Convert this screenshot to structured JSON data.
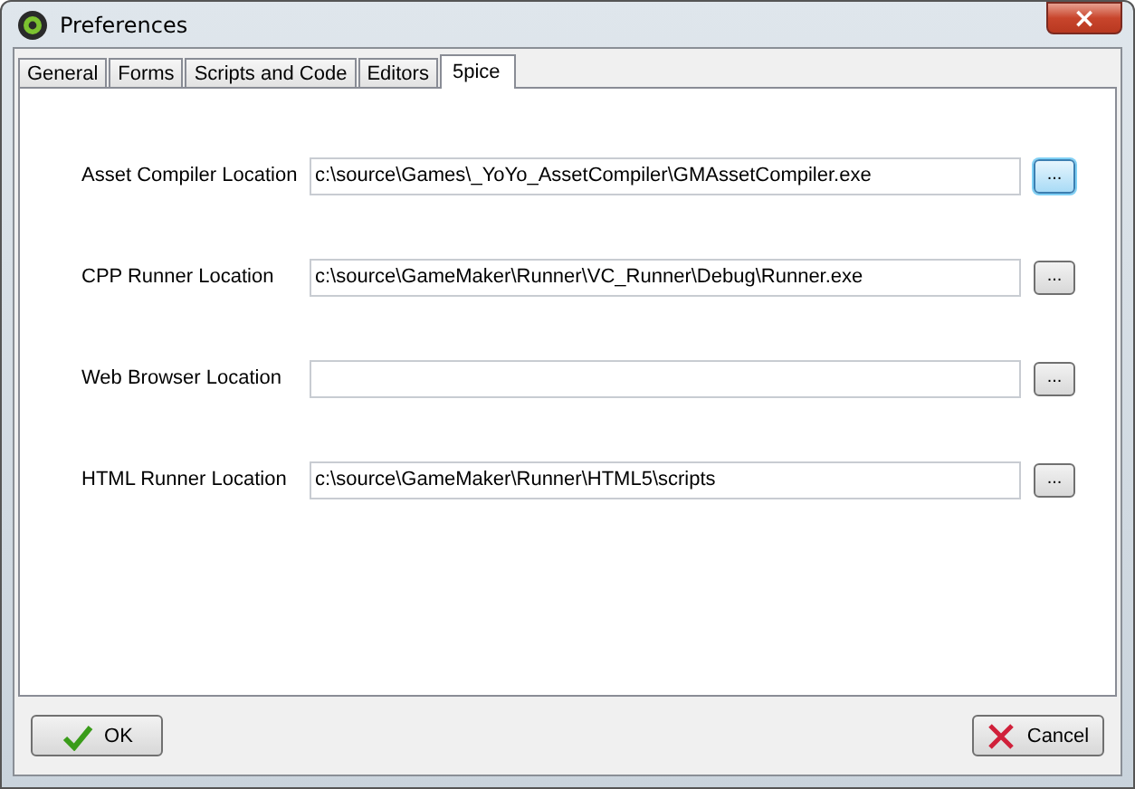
{
  "window": {
    "title": "Preferences",
    "close": "×"
  },
  "tabs": [
    {
      "label": "General",
      "selected": false
    },
    {
      "label": "Forms",
      "selected": false
    },
    {
      "label": "Scripts and Code",
      "selected": false
    },
    {
      "label": "Editors",
      "selected": false
    },
    {
      "label": "5pice",
      "selected": true
    }
  ],
  "settings": [
    {
      "label": "Asset Compiler Location",
      "value": "c:\\source\\Games\\_YoYo_AssetCompiler\\GMAssetCompiler.exe",
      "browse": "...",
      "focused": true
    },
    {
      "label": "CPP Runner Location",
      "value": "c:\\source\\GameMaker\\Runner\\VC_Runner\\Debug\\Runner.exe",
      "browse": "...",
      "focused": false
    },
    {
      "label": "Web Browser Location",
      "browse": "...",
      "focused": false
    },
    {
      "label": "HTML Runner Location",
      "value": "c:\\source\\GameMaker\\Runner\\HTML5\\scripts",
      "browse": "...",
      "focused": false
    }
  ],
  "buttons": [
    {
      "label": "OK",
      "kind": "ok"
    },
    {
      "label": "Cancel",
      "kind": "cancel"
    }
  ]
}
